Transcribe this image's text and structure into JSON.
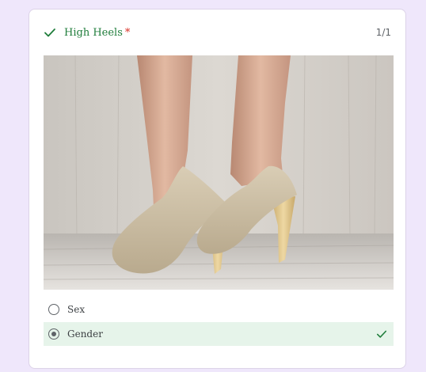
{
  "question": {
    "title": "High Heels",
    "required_marker": "*",
    "score": "1/1",
    "status_icon": "check-icon",
    "image": {
      "subject": "beige high heels photo"
    },
    "options": [
      {
        "label": "Sex",
        "selected": false
      },
      {
        "label": "Gender",
        "selected": true,
        "correct_icon": "check-icon"
      }
    ]
  },
  "colors": {
    "background": "#efe7fb",
    "correct_green": "#1f7d3b",
    "selected_bg": "#e6f4ea",
    "required_red": "#d93025"
  }
}
